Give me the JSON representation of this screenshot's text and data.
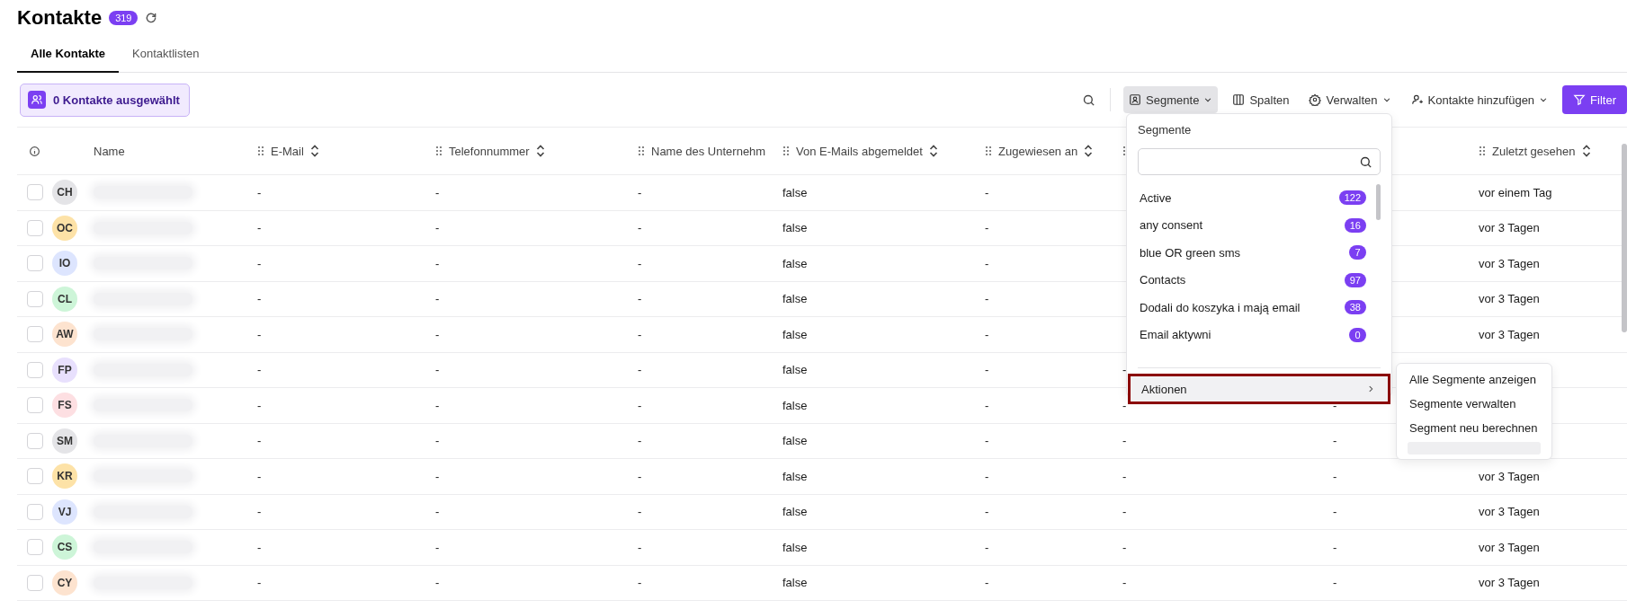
{
  "header": {
    "title": "Kontakte",
    "count": "319"
  },
  "tabs": [
    {
      "label": "Alle Kontakte",
      "selected": true
    },
    {
      "label": "Kontaktlisten",
      "selected": false
    }
  ],
  "selection": {
    "label": "0 Kontakte ausgewählt"
  },
  "toolbar": [
    {
      "kind": "segments",
      "label": "Segmente",
      "dropdown": true,
      "open": true,
      "primary": false
    },
    {
      "kind": "columns",
      "label": "Spalten",
      "dropdown": false,
      "open": false,
      "primary": false
    },
    {
      "kind": "manage",
      "label": "Verwalten",
      "dropdown": true,
      "open": false,
      "primary": false
    },
    {
      "kind": "add",
      "label": "Kontakte hinzufügen",
      "dropdown": true,
      "open": false,
      "primary": false
    },
    {
      "kind": "filter",
      "label": "Filter",
      "dropdown": false,
      "open": false,
      "primary": true
    }
  ],
  "table": {
    "columns": [
      {
        "label": "E-Mail",
        "draggable": true,
        "sortable": true
      },
      {
        "label": "Telefonnummer",
        "draggable": true,
        "sortable": true
      },
      {
        "label": "Name des Unternehm",
        "draggable": true,
        "sortable": false
      },
      {
        "label": "Von E-Mails abgemeldet",
        "draggable": true,
        "sortable": true
      },
      {
        "label": "Zugewiesen an",
        "draggable": true,
        "sortable": true
      },
      {
        "draggable": true
      },
      {},
      {
        "label": "Zuletzt gesehen",
        "draggable": true,
        "sortable": true
      }
    ],
    "name_column": "Name",
    "rows": [
      {
        "initials": "CH",
        "color": "#e4e4e7",
        "checked": false,
        "cells": [
          "-",
          "-",
          "-",
          "false",
          "-",
          null,
          null,
          "vor einem Tag"
        ]
      },
      {
        "initials": "OC",
        "color": "#fde2a7",
        "checked": false,
        "cells": [
          "-",
          "-",
          "-",
          "false",
          "-",
          null,
          null,
          "vor 3 Tagen"
        ]
      },
      {
        "initials": "IO",
        "color": "#dde5fe",
        "checked": false,
        "cells": [
          "-",
          "-",
          "-",
          "false",
          "-",
          null,
          null,
          "vor 3 Tagen"
        ]
      },
      {
        "initials": "CL",
        "color": "#cdf5d8",
        "checked": false,
        "cells": [
          "-",
          "-",
          "-",
          "false",
          "-",
          null,
          null,
          "vor 3 Tagen"
        ]
      },
      {
        "initials": "AW",
        "color": "#fde3cf",
        "checked": false,
        "cells": [
          "-",
          "-",
          "-",
          "false",
          "-",
          null,
          null,
          "vor 3 Tagen"
        ]
      },
      {
        "initials": "FP",
        "color": "#e8e0fd",
        "checked": false,
        "cells": [
          "-",
          "-",
          "-",
          "false",
          "-",
          "-",
          null,
          null
        ]
      },
      {
        "initials": "FS",
        "color": "#fddfe2",
        "checked": false,
        "cells": [
          "-",
          "-",
          "-",
          "false",
          "-",
          "-",
          "-",
          null
        ]
      },
      {
        "initials": "SM",
        "color": "#e4e4e7",
        "checked": false,
        "cells": [
          "-",
          "-",
          "-",
          "false",
          "-",
          "-",
          "-",
          null
        ]
      },
      {
        "initials": "KR",
        "color": "#fde2a7",
        "checked": false,
        "cells": [
          "-",
          "-",
          "-",
          "false",
          "-",
          "-",
          "-",
          "vor 3 Tagen"
        ]
      },
      {
        "initials": "VJ",
        "color": "#dde5fe",
        "checked": false,
        "cells": [
          "-",
          "-",
          "-",
          "false",
          "-",
          "-",
          "-",
          "vor 3 Tagen"
        ]
      },
      {
        "initials": "CS",
        "color": "#cdf5d8",
        "checked": false,
        "cells": [
          "-",
          "-",
          "-",
          "false",
          "-",
          "-",
          "-",
          "vor 3 Tagen"
        ]
      },
      {
        "initials": "CY",
        "color": "#fde3cf",
        "checked": false,
        "cells": [
          "-",
          "-",
          "-",
          "false",
          "-",
          "-",
          "-",
          "vor 3 Tagen"
        ]
      }
    ]
  },
  "segments_menu": {
    "title": "Segmente",
    "items": [
      {
        "name": "Active",
        "count": "122"
      },
      {
        "name": "any consent",
        "count": "16"
      },
      {
        "name": "blue OR green sms",
        "count": "7"
      },
      {
        "name": "Contacts",
        "count": "97"
      },
      {
        "name": "Dodali do koszyka i mają email",
        "count": "38"
      },
      {
        "name": "Email aktywni",
        "count": "0"
      }
    ],
    "actions": {
      "label": "Aktionen",
      "highlighted": true
    },
    "submenu": [
      "Alle Segmente anzeigen",
      "Segmente verwalten",
      "Segment neu berechnen"
    ]
  }
}
